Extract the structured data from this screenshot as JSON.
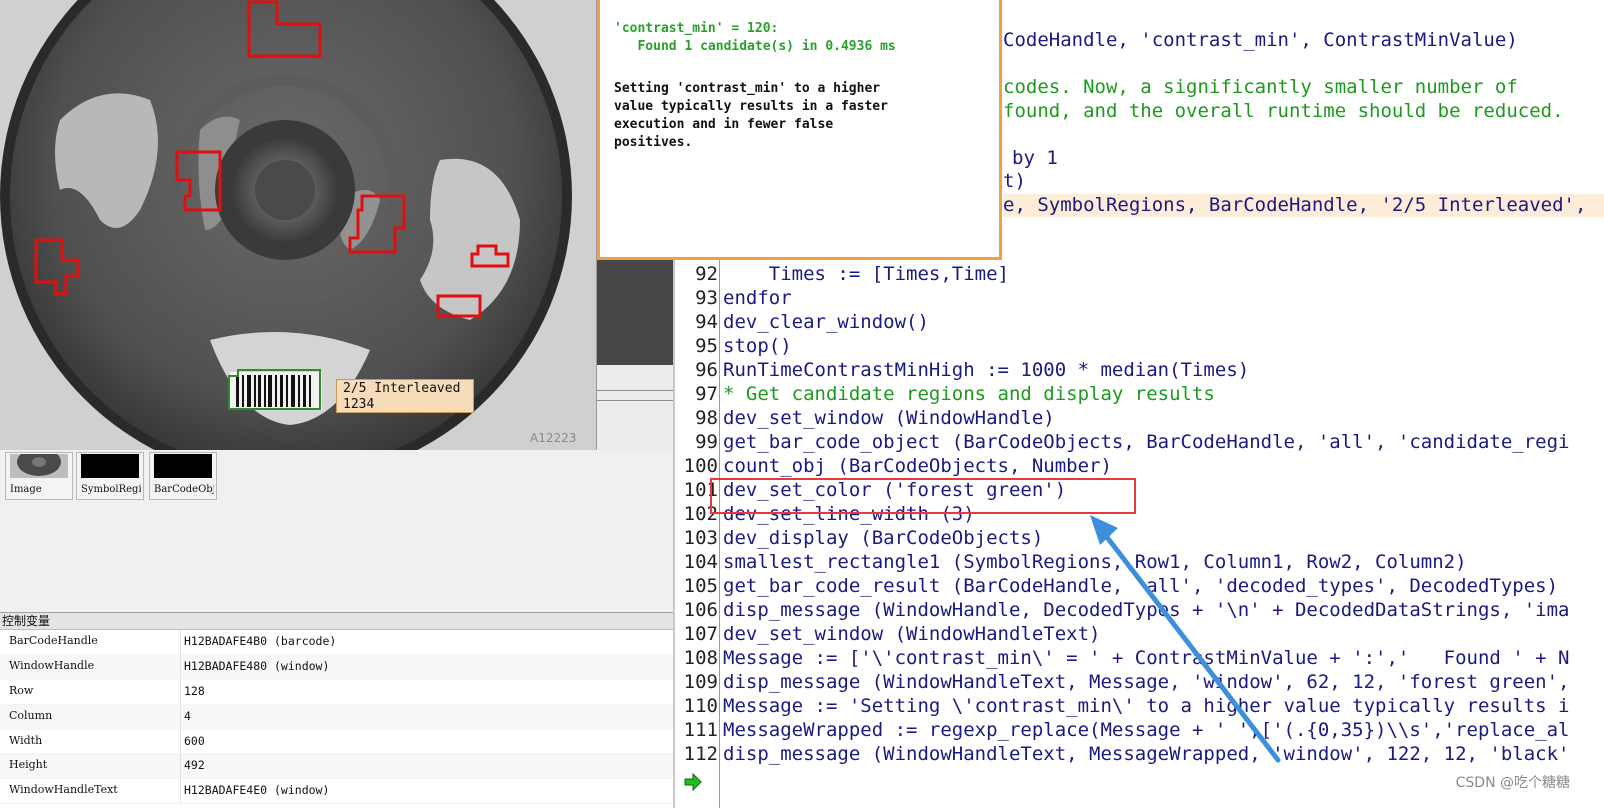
{
  "popup": {
    "line1": "'contrast_min' = 120:",
    "line2": "   Found 1 candidate(s) in 0.4936 ms",
    "body": "Setting 'contrast_min' to a higher\nvalue typically results in a faster\nexecution and in fewer false\npositives."
  },
  "barcode_label": {
    "type": "2/5 Interleaved",
    "value": "1234"
  },
  "thumbnails": [
    "Image",
    "SymbolRegi",
    "BarCodeObj"
  ],
  "vars": {
    "header": "控制变量",
    "rows": [
      {
        "name": "BarCodeHandle",
        "value": "H12BADAFE4B0 (barcode)"
      },
      {
        "name": "WindowHandle",
        "value": "H12BADAFE480 (window)"
      },
      {
        "name": "Row",
        "value": "128"
      },
      {
        "name": "Column",
        "value": "4"
      },
      {
        "name": "Width",
        "value": "600"
      },
      {
        "name": "Height",
        "value": "492"
      },
      {
        "name": "WindowHandleText",
        "value": "H12BADAFE4E0 (window)"
      }
    ]
  },
  "editor": {
    "partial_lines": [
      "CodeHandle, 'contrast_min', ContrastMinValue)",
      "codes. Now, a significantly smaller number of",
      "found, and the overall runtime should be reduced.",
      "by 1",
      "t)",
      "e, SymbolRegions, BarCodeHandle, '2/5 Interleaved',"
    ],
    "lines": [
      {
        "n": "92",
        "text": "    Times := [Times,Time]"
      },
      {
        "n": "93",
        "text": "endfor"
      },
      {
        "n": "94",
        "text": "dev_clear_window()"
      },
      {
        "n": "95",
        "text": "stop()"
      },
      {
        "n": "96",
        "text": "RunTimeContrastMinHigh := 1000 * median(Times)"
      },
      {
        "n": "97",
        "text": "* Get candidate regions and display results"
      },
      {
        "n": "98",
        "text": "dev_set_window (WindowHandle)"
      },
      {
        "n": "99",
        "text": "get_bar_code_object (BarCodeObjects, BarCodeHandle, 'all', 'candidate_regi"
      },
      {
        "n": "100",
        "text": "count_obj (BarCodeObjects, Number)"
      },
      {
        "n": "101",
        "text": "dev_set_color ('forest green')"
      },
      {
        "n": "102",
        "text": "dev_set_line_width (3)"
      },
      {
        "n": "103",
        "text": "dev_display (BarCodeObjects)"
      },
      {
        "n": "104",
        "text": "smallest_rectangle1 (SymbolRegions, Row1, Column1, Row2, Column2)"
      },
      {
        "n": "105",
        "text": "get_bar_code_result (BarCodeHandle, 'all', 'decoded_types', DecodedTypes)"
      },
      {
        "n": "106",
        "text": "disp_message (WindowHandle, DecodedTypes + '\\n' + DecodedDataStrings, 'ima"
      },
      {
        "n": "107",
        "text": "dev_set_window (WindowHandleText)"
      },
      {
        "n": "108",
        "text": "Message := ['\\'contrast_min\\' = ' + ContrastMinValue + ':','   Found ' + N"
      },
      {
        "n": "109",
        "text": "disp_message (WindowHandleText, Message, 'window', 62, 12, 'forest green',"
      },
      {
        "n": "110",
        "text": "Message := 'Setting \\'contrast_min\\' to a higher value typically results i"
      },
      {
        "n": "111",
        "text": "MessageWrapped := regexp_replace(Message + ' ',['(.{0,35})\\\\s','replace_al"
      },
      {
        "n": "112",
        "text": "disp_message (WindowHandleText, MessageWrapped, 'window', 122, 12, 'black'"
      }
    ]
  },
  "watermark": "CSDN @吃个糖糖",
  "colors": {
    "comment": "#1d9a1d",
    "code": "#1a1a80",
    "highlight_box": "#e8373d",
    "popup_border": "#f0a040",
    "annotation_arrow": "#3d8fdc"
  }
}
